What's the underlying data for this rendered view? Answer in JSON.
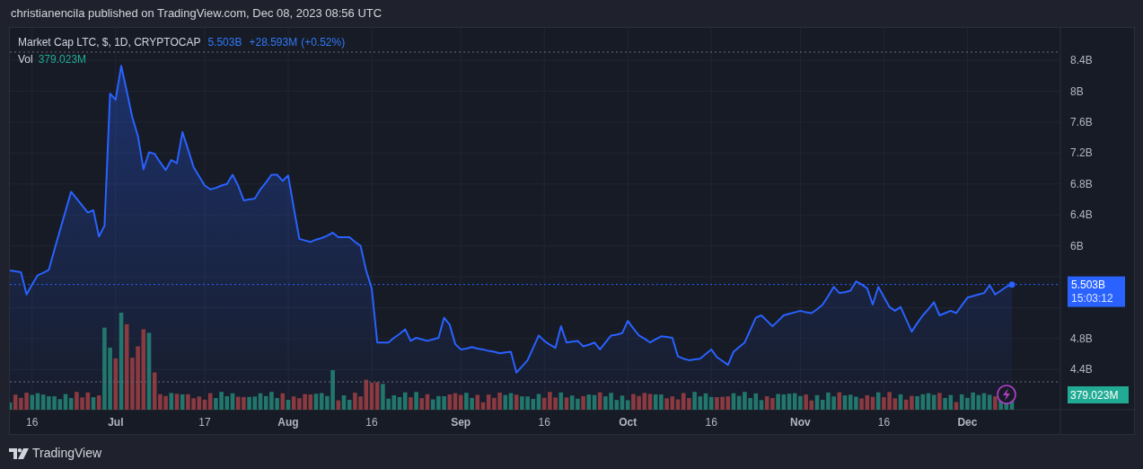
{
  "header": {
    "text": "christianencila published on TradingView.com, Dec 08, 2023 08:56 UTC"
  },
  "legend": {
    "symbol": "Market Cap LTC, $, 1D, CRYPTOCAP",
    "value": "5.503B",
    "change": "+28.593M",
    "change_pct": "(+0.52%)",
    "volume_label": "Vol",
    "volume_value": "379.023M"
  },
  "chart": {
    "chart_data": {
      "type": "area",
      "grid": true,
      "ylim": [
        3.88,
        8.82
      ],
      "yticks": [
        {
          "value": 4.4,
          "label": "4.4B"
        },
        {
          "value": 4.8,
          "label": "4.8B"
        },
        {
          "value": 6,
          "label": "6B"
        },
        {
          "value": 6.4,
          "label": "6.4B"
        },
        {
          "value": 6.8,
          "label": "6.8B"
        },
        {
          "value": 7.2,
          "label": "7.2B"
        },
        {
          "value": 7.6,
          "label": "7.6B"
        },
        {
          "value": 8,
          "label": "8B"
        },
        {
          "value": 8.4,
          "label": "8.4B"
        }
      ],
      "categories": [
        null,
        null,
        null,
        null,
        "16",
        null,
        null,
        null,
        null,
        null,
        null,
        null,
        null,
        null,
        null,
        null,
        null,
        null,
        null,
        "Jul",
        null,
        null,
        null,
        null,
        null,
        null,
        null,
        null,
        null,
        null,
        null,
        null,
        null,
        null,
        null,
        "17",
        null,
        null,
        null,
        null,
        null,
        null,
        null,
        null,
        null,
        null,
        null,
        null,
        null,
        null,
        "Aug",
        null,
        null,
        null,
        null,
        null,
        null,
        null,
        null,
        null,
        null,
        null,
        null,
        null,
        null,
        "16",
        null,
        null,
        null,
        null,
        null,
        null,
        null,
        null,
        null,
        null,
        null,
        null,
        null,
        null,
        null,
        "Sep",
        null,
        null,
        null,
        null,
        null,
        null,
        null,
        null,
        null,
        null,
        null,
        null,
        null,
        null,
        "16",
        null,
        null,
        null,
        null,
        null,
        null,
        null,
        null,
        null,
        null,
        null,
        null,
        null,
        null,
        "Oct",
        null,
        null,
        null,
        null,
        null,
        null,
        null,
        null,
        null,
        null,
        null,
        null,
        null,
        null,
        "16",
        null,
        null,
        null,
        null,
        null,
        null,
        null,
        null,
        null,
        null,
        null,
        null,
        null,
        null,
        null,
        "Nov",
        null,
        null,
        null,
        null,
        null,
        null,
        null,
        null,
        null,
        null,
        null,
        null,
        null,
        null,
        "16",
        null,
        null,
        null,
        null,
        null,
        null,
        null,
        null,
        null,
        null,
        null,
        null,
        null,
        null,
        "Dec",
        null,
        null,
        null,
        null,
        null,
        null,
        null,
        null
      ],
      "series": [
        {
          "color": "#2962ff",
          "values": [
            5.68,
            5.67,
            5.66,
            5.37,
            5.5,
            5.62,
            5.65,
            5.69,
            5.95,
            6.2,
            6.45,
            6.7,
            6.61,
            6.52,
            6.43,
            6.46,
            6.12,
            6.26,
            7.97,
            7.89,
            8.33,
            8.0,
            7.66,
            7.42,
            6.99,
            7.21,
            7.19,
            7.08,
            6.98,
            7.11,
            7.07,
            7.47,
            7.25,
            7.02,
            6.9,
            6.78,
            6.73,
            6.75,
            6.78,
            6.8,
            6.92,
            6.78,
            6.59,
            6.6,
            6.61,
            6.73,
            6.82,
            6.92,
            6.92,
            6.84,
            6.91,
            6.49,
            6.09,
            6.07,
            6.05,
            6.08,
            6.1,
            6.13,
            6.17,
            6.11,
            6.11,
            6.11,
            6.05,
            6.0,
            5.68,
            5.45,
            4.75,
            4.75,
            4.75,
            4.81,
            4.86,
            4.92,
            4.77,
            4.81,
            4.79,
            4.77,
            4.79,
            4.81,
            5.07,
            4.98,
            4.73,
            4.66,
            4.67,
            4.69,
            4.67,
            4.66,
            4.64,
            4.63,
            4.61,
            4.62,
            4.63,
            4.36,
            4.44,
            4.52,
            4.68,
            4.84,
            4.77,
            4.72,
            4.68,
            4.96,
            4.75,
            4.76,
            4.77,
            4.7,
            4.72,
            4.75,
            4.66,
            4.75,
            4.84,
            4.85,
            4.87,
            5.03,
            4.93,
            4.84,
            4.8,
            4.75,
            4.79,
            4.83,
            4.82,
            4.81,
            4.57,
            4.54,
            4.52,
            4.53,
            4.54,
            4.6,
            4.66,
            4.56,
            4.51,
            4.46,
            4.63,
            4.69,
            4.75,
            4.91,
            5.07,
            5.1,
            5.03,
            4.96,
            5.03,
            5.1,
            5.12,
            5.14,
            5.16,
            5.14,
            5.13,
            5.18,
            5.24,
            5.35,
            5.47,
            5.39,
            5.4,
            5.42,
            5.54,
            5.5,
            5.45,
            5.24,
            5.47,
            5.34,
            5.21,
            5.16,
            5.21,
            5.05,
            4.89,
            5.0,
            5.1,
            5.18,
            5.27,
            5.1,
            5.13,
            5.16,
            5.13,
            5.23,
            5.33,
            5.35,
            5.37,
            5.39,
            5.49,
            5.37,
            5.42,
            5.47,
            5.5
          ]
        }
      ]
    },
    "price_tag": {
      "value": "5.503B",
      "countdown": "15:03:12"
    },
    "volume_tag": "379.023M"
  },
  "footer": {
    "brand": "TradingView"
  }
}
